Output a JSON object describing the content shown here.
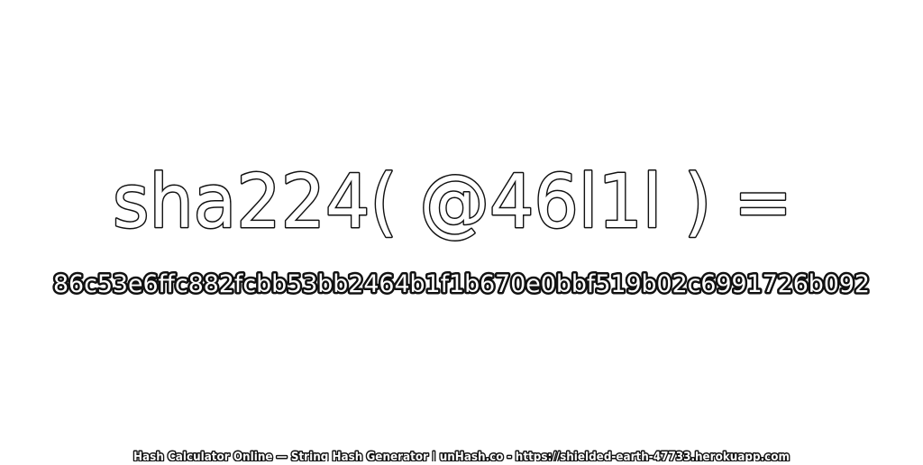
{
  "heading": {
    "expression": "sha224( @46l1l ) =",
    "hash_value": "86c53e6ffc882fcbb53bb2464b1f1b670e0bbf519b02c6991726b092"
  },
  "footer": {
    "text": "Hash Calculator Online — String Hash Generator | unHash.co - https://shielded-earth-47733.herokuapp.com"
  },
  "colors": {
    "background": "#ffffff",
    "text_fill": "#ffffff",
    "text_outline": "#111111"
  }
}
